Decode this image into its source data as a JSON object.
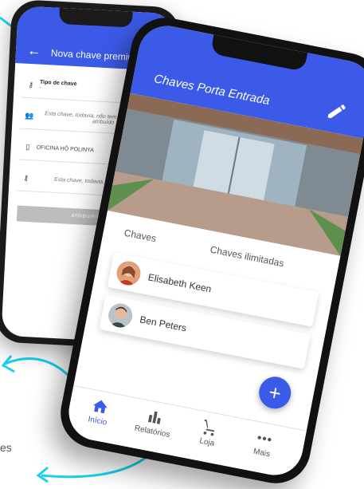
{
  "colors": {
    "accent": "#3c5ae8",
    "arrow": "#1ad2ef"
  },
  "back_screen": {
    "title": "Nova chave premium",
    "fields": [
      {
        "icon": "key-icon",
        "label": "Tipo de chave",
        "value": "-"
      },
      {
        "icon": "user-add-icon",
        "text": "Esta chave, todavia, não tem nenhum utilizador atribuído"
      },
      {
        "icon": "phone-icon",
        "text": "OFICINA HÔ POLINYA"
      },
      {
        "icon": "key-icon",
        "text": "Esta chave, todavia, não tem um tipo"
      }
    ],
    "button": "ATRIBUIR CHAVE"
  },
  "front_screen": {
    "title": "Chaves Porta Entrada",
    "tabs": [
      "Chaves",
      "Chaves ilimitadas"
    ],
    "contacts": [
      {
        "name": "Elisabeth Keen"
      },
      {
        "name": "Ben Peters"
      }
    ],
    "fab": "+",
    "nav": [
      {
        "label": "Início",
        "icon": "home-icon",
        "active": true
      },
      {
        "label": "Relatórios",
        "icon": "bar-chart-icon",
        "active": false
      },
      {
        "label": "Loja",
        "icon": "cart-icon",
        "active": false
      },
      {
        "label": "Mais",
        "icon": "more-icon",
        "active": false
      }
    ]
  },
  "partial_caption": "es"
}
